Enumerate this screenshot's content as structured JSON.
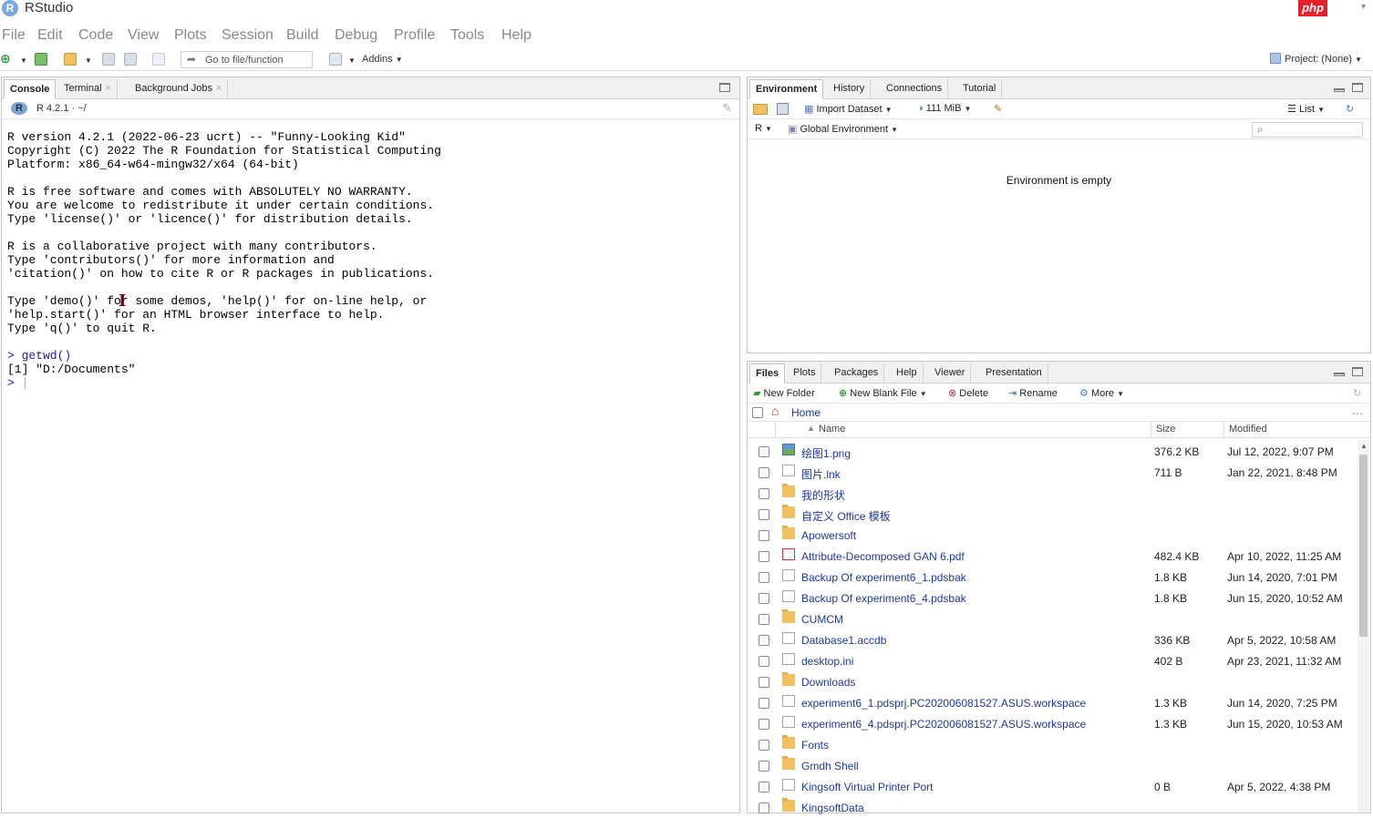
{
  "window": {
    "title": "RStudio",
    "logo": "R",
    "badge": "php"
  },
  "menu": [
    "File",
    "Edit",
    "Code",
    "View",
    "Plots",
    "Session",
    "Build",
    "Debug",
    "Profile",
    "Tools",
    "Help"
  ],
  "toolbar": {
    "goto_placeholder": "Go to file/function",
    "addins_label": "Addins",
    "project_label": "Project: (None)"
  },
  "console": {
    "tabs": [
      "Console",
      "Terminal",
      "Background Jobs"
    ],
    "version": "R 4.2.1 · ~/",
    "lines": [
      "R version 4.2.1 (2022-06-23 ucrt) -- \"Funny-Looking Kid\"",
      "Copyright (C) 2022 The R Foundation for Statistical Computing",
      "Platform: x86_64-w64-mingw32/x64 (64-bit)",
      "",
      "R is free software and comes with ABSOLUTELY NO WARRANTY.",
      "You are welcome to redistribute it under certain conditions.",
      "Type 'license()' or 'licence()' for distribution details.",
      "",
      "R is a collaborative project with many contributors.",
      "Type 'contributors()' for more information and",
      "'citation()' on how to cite R or R packages in publications.",
      "",
      "Type 'demo()' for some demos, 'help()' for on-line help, or",
      "'help.start()' for an HTML browser interface to help.",
      "Type 'q()' to quit R.",
      ""
    ],
    "command": "> getwd()",
    "output": "[1] \"D:/Documents\"",
    "prompt": "> "
  },
  "environment": {
    "tabs": [
      "Environment",
      "History",
      "Connections",
      "Tutorial"
    ],
    "import_label": "Import Dataset",
    "memory_label": "111 MiB",
    "list_label": "List",
    "lang_label": "R",
    "scope_label": "Global Environment",
    "empty_message": "Environment is empty"
  },
  "files": {
    "tabs": [
      "Files",
      "Plots",
      "Packages",
      "Help",
      "Viewer",
      "Presentation"
    ],
    "toolbar": {
      "new_folder": "New Folder",
      "new_blank_file": "New Blank File",
      "delete": "Delete",
      "rename": "Rename",
      "more": "More"
    },
    "path": "Home",
    "columns": {
      "name": "Name",
      "size": "Size",
      "modified": "Modified"
    },
    "rows": [
      {
        "icon": "image",
        "name": "绘图1.png",
        "size": "376.2 KB",
        "modified": "Jul 12, 2022, 9:07 PM"
      },
      {
        "icon": "file",
        "name": "图片.lnk",
        "size": "711 B",
        "modified": "Jan 22, 2021, 8:48 PM"
      },
      {
        "icon": "folder",
        "name": "我的形状",
        "size": "",
        "modified": ""
      },
      {
        "icon": "folder",
        "name": "自定义 Office 模板",
        "size": "",
        "modified": ""
      },
      {
        "icon": "folder",
        "name": "Apowersoft",
        "size": "",
        "modified": ""
      },
      {
        "icon": "pdf",
        "name": "Attribute-Decomposed GAN 6.pdf",
        "size": "482.4 KB",
        "modified": "Apr 10, 2022, 11:25 AM"
      },
      {
        "icon": "file",
        "name": "Backup Of experiment6_1.pdsbak",
        "size": "1.8 KB",
        "modified": "Jun 14, 2020, 7:01 PM"
      },
      {
        "icon": "file",
        "name": "Backup Of experiment6_4.pdsbak",
        "size": "1.8 KB",
        "modified": "Jun 15, 2020, 10:52 AM"
      },
      {
        "icon": "folder",
        "name": "CUMCM",
        "size": "",
        "modified": ""
      },
      {
        "icon": "file",
        "name": "Database1.accdb",
        "size": "336 KB",
        "modified": "Apr 5, 2022, 10:58 AM"
      },
      {
        "icon": "ini",
        "name": "desktop.ini",
        "size": "402 B",
        "modified": "Apr 23, 2021, 11:32 AM"
      },
      {
        "icon": "folder",
        "name": "Downloads",
        "size": "",
        "modified": ""
      },
      {
        "icon": "file",
        "name": "experiment6_1.pdsprj.PC202006081527.ASUS.workspace",
        "size": "1.3 KB",
        "modified": "Jun 14, 2020, 7:25 PM"
      },
      {
        "icon": "file",
        "name": "experiment6_4.pdsprj.PC202006081527.ASUS.workspace",
        "size": "1.3 KB",
        "modified": "Jun 15, 2020, 10:53 AM"
      },
      {
        "icon": "folder",
        "name": "Fonts",
        "size": "",
        "modified": ""
      },
      {
        "icon": "folder",
        "name": "Gmdh Shell",
        "size": "",
        "modified": ""
      },
      {
        "icon": "file",
        "name": "Kingsoft Virtual Printer Port",
        "size": "0 B",
        "modified": "Apr 5, 2022, 4:38 PM"
      },
      {
        "icon": "folder",
        "name": "KingsoftData",
        "size": "",
        "modified": ""
      }
    ]
  }
}
